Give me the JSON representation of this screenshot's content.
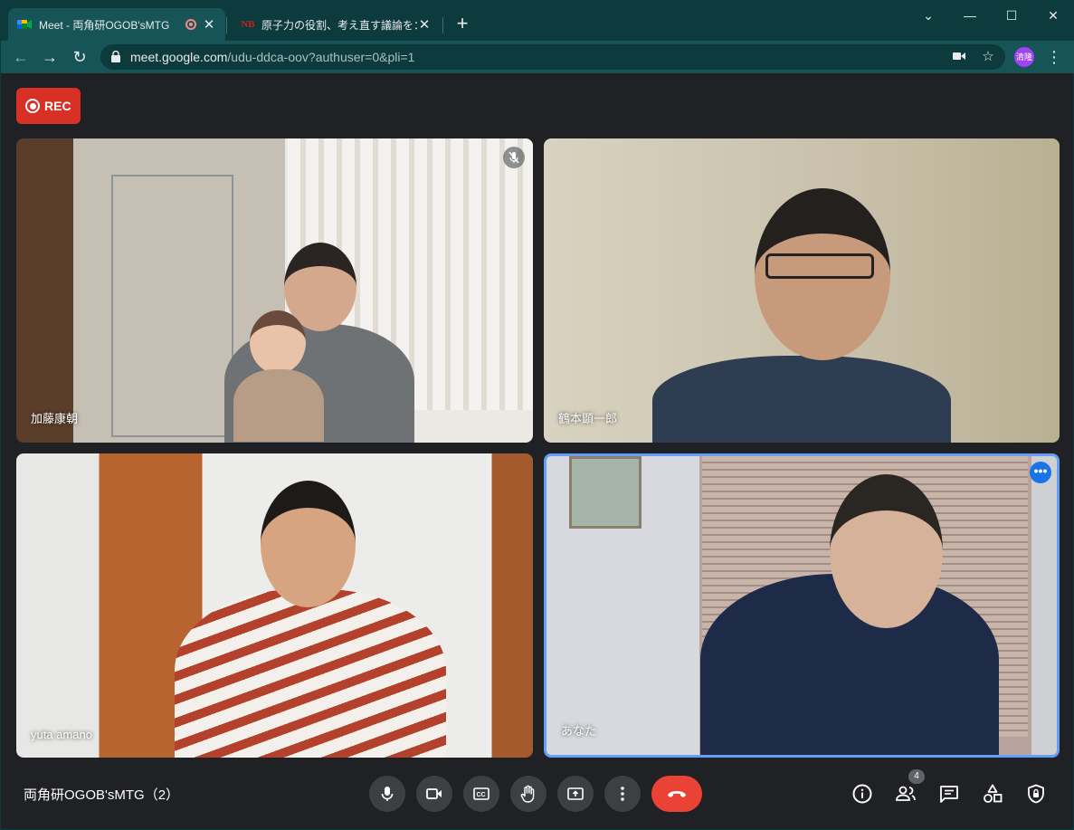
{
  "browser": {
    "tabs": [
      {
        "title": "Meet - 両角研OGOB'sMTG",
        "active": true
      },
      {
        "title": "原子力の役割、考え直す議論を：日",
        "favicon_text": "NB",
        "active": false
      }
    ],
    "new_tab_label": "+",
    "url_host": "meet.google.com",
    "url_path": "/udu-ddca-oov?authuser=0&pli=1",
    "profile_label": "清隆"
  },
  "recording": {
    "label": "REC",
    "color": "#d93025"
  },
  "participants": [
    {
      "name": "加藤康朝",
      "muted": true
    },
    {
      "name": "鶴本顕一郎",
      "muted": false
    },
    {
      "name": "yuta amano",
      "muted": false
    },
    {
      "name": "あなた",
      "muted": false,
      "self": true,
      "highlight_color": "#669df6"
    }
  ],
  "footer": {
    "meeting_title": "両角研OGOB'sMTG（2）",
    "controls": [
      "mic-icon",
      "camera-icon",
      "captions-icon",
      "raise-hand-icon",
      "present-icon",
      "more-options-icon",
      "leave-call-icon"
    ],
    "right_icons": [
      "info-icon",
      "people-icon",
      "chat-icon",
      "activities-icon",
      "host-controls-icon"
    ],
    "participant_count": "4",
    "leave_color": "#ea4335"
  }
}
